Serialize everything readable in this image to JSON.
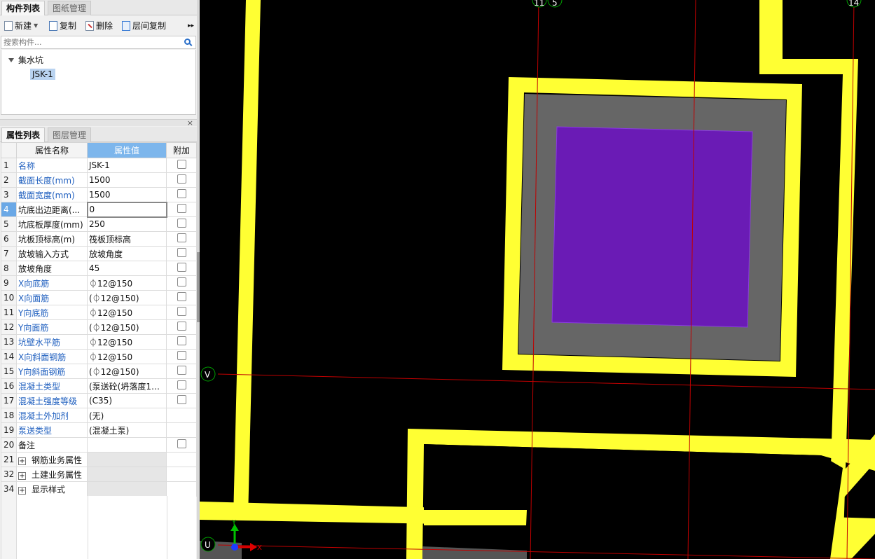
{
  "component_panel": {
    "tabs": [
      "构件列表",
      "图纸管理"
    ],
    "toolbar": {
      "new": "新建",
      "copy": "复制",
      "delete": "删除",
      "floor_copy": "层间复制",
      "more": "▸▸"
    },
    "search_placeholder": "搜索构件...",
    "tree": {
      "root": "集水坑",
      "child": "JSK-1"
    }
  },
  "property_panel": {
    "close": "×",
    "tabs": [
      "属性列表",
      "图层管理"
    ],
    "headers": [
      "属性名称",
      "属性值",
      "附加"
    ],
    "rows": [
      {
        "num": "1",
        "name": "名称",
        "value": "JSK-1"
      },
      {
        "num": "2",
        "name": "截面长度(mm)",
        "value": "1500"
      },
      {
        "num": "3",
        "name": "截面宽度(mm)",
        "value": "1500"
      },
      {
        "num": "4",
        "name": "坑底出边距离(...",
        "value": "0"
      },
      {
        "num": "5",
        "name": "坑底板厚度(mm)",
        "value": "250"
      },
      {
        "num": "6",
        "name": "坑板顶标高(m)",
        "value": "筏板顶标高"
      },
      {
        "num": "7",
        "name": "放坡输入方式",
        "value": "放坡角度"
      },
      {
        "num": "8",
        "name": "放坡角度",
        "value": "45"
      },
      {
        "num": "9",
        "name": "X向底筋",
        "value": "⏀12@150"
      },
      {
        "num": "10",
        "name": "X向面筋",
        "value": "(⏀12@150)"
      },
      {
        "num": "11",
        "name": "Y向底筋",
        "value": "⏀12@150"
      },
      {
        "num": "12",
        "name": "Y向面筋",
        "value": "(⏀12@150)"
      },
      {
        "num": "13",
        "name": "坑壁水平筋",
        "value": "⏀12@150"
      },
      {
        "num": "14",
        "name": "X向斜面钢筋",
        "value": "⏀12@150"
      },
      {
        "num": "15",
        "name": "Y向斜面钢筋",
        "value": "(⏀12@150)"
      },
      {
        "num": "16",
        "name": "混凝土类型",
        "value": "(泵送砼(坍落度17..."
      },
      {
        "num": "17",
        "name": "混凝土强度等级",
        "value": "(C35)"
      },
      {
        "num": "18",
        "name": "混凝土外加剂",
        "value": "(无)"
      },
      {
        "num": "19",
        "name": "泵送类型",
        "value": "(混凝土泵)"
      },
      {
        "num": "20",
        "name": "备注",
        "value": ""
      },
      {
        "num": "21",
        "name": "钢筋业务属性",
        "value": ""
      },
      {
        "num": "32",
        "name": "土建业务属性",
        "value": ""
      },
      {
        "num": "34",
        "name": "显示样式",
        "value": ""
      }
    ]
  },
  "canvas": {
    "axis_labels": {
      "top_11": "11",
      "top_5": "5",
      "top_14": "14",
      "left_v": "V",
      "left_u": "U",
      "ucs_y": "Y",
      "ucs_x": "X"
    },
    "colors": {
      "background": "#000000",
      "wall": "#ffff33",
      "slope": "#666666",
      "pit_bottom": "#6a1bb5",
      "grid_line": "#c00000",
      "axis_circle": "#00a000"
    }
  }
}
